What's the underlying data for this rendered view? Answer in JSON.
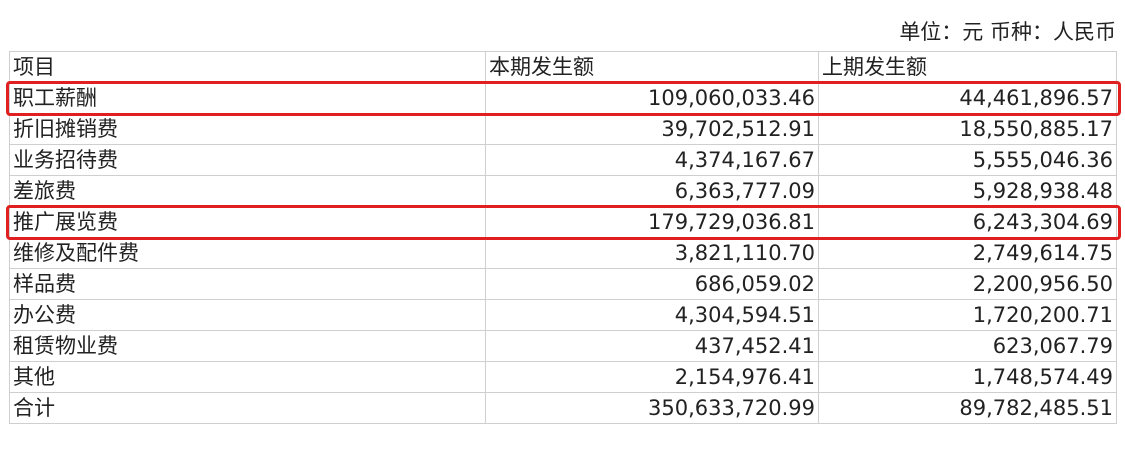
{
  "unit_line": "单位：元 币种：人民币",
  "table": {
    "headers": [
      "项目",
      "本期发生额",
      "上期发生额"
    ],
    "rows": [
      {
        "item": "职工薪酬",
        "current": "109,060,033.46",
        "previous": "44,461,896.57",
        "highlighted": true
      },
      {
        "item": "折旧摊销费",
        "current": "39,702,512.91",
        "previous": "18,550,885.17",
        "highlighted": false
      },
      {
        "item": "业务招待费",
        "current": "4,374,167.67",
        "previous": "5,555,046.36",
        "highlighted": false
      },
      {
        "item": "差旅费",
        "current": "6,363,777.09",
        "previous": "5,928,938.48",
        "highlighted": false
      },
      {
        "item": "推广展览费",
        "current": "179,729,036.81",
        "previous": "6,243,304.69",
        "highlighted": true
      },
      {
        "item": "维修及配件费",
        "current": "3,821,110.70",
        "previous": "2,749,614.75",
        "highlighted": false
      },
      {
        "item": "样品费",
        "current": "686,059.02",
        "previous": "2,200,956.50",
        "highlighted": false
      },
      {
        "item": "办公费",
        "current": "4,304,594.51",
        "previous": "1,720,200.71",
        "highlighted": false
      },
      {
        "item": "租赁物业费",
        "current": "437,452.41",
        "previous": "623,067.79",
        "highlighted": false
      },
      {
        "item": "其他",
        "current": "2,154,976.41",
        "previous": "1,748,574.49",
        "highlighted": false
      },
      {
        "item": "合计",
        "current": "350,633,720.99",
        "previous": "89,782,485.51",
        "highlighted": false
      }
    ]
  },
  "colors": {
    "highlight_border": "#e02020",
    "grid_line": "#cfcfcf",
    "text": "#222222"
  }
}
